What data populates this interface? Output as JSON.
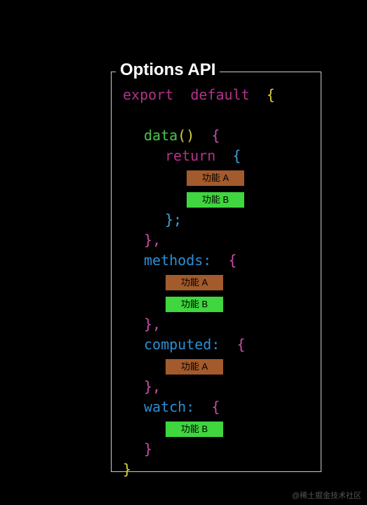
{
  "title": "Options API",
  "code": {
    "export": "export",
    "default": "default",
    "data": "data",
    "return": "return",
    "methods": "methods:",
    "computed": "computed:",
    "watch": "watch:"
  },
  "tags": {
    "featureA": "功能 A",
    "featureB": "功能 B"
  },
  "watermark": "@稀土掘金技术社区"
}
